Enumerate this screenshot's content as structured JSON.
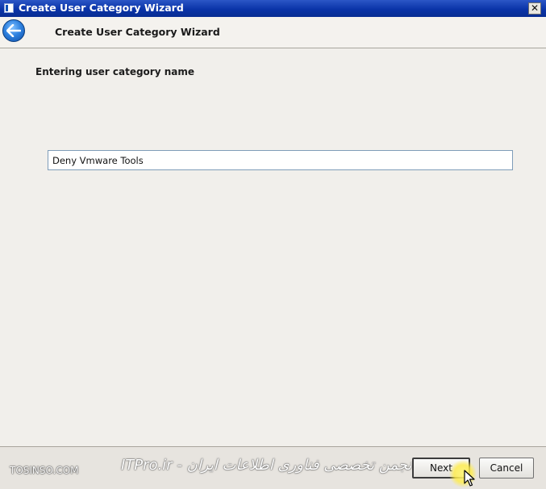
{
  "window": {
    "title": "Create User Category Wizard",
    "close_glyph": "✕"
  },
  "header": {
    "back_icon": "back-arrow-icon",
    "title": "Create User Category Wizard"
  },
  "main": {
    "section_label": "Entering user category name",
    "name_input_value": "Deny Vmware Tools"
  },
  "footer": {
    "watermark_left": "TOSINSO.COM",
    "watermark_center": "ITPro.ir - انجمن تخصصی فناوری اطلاعات ایران",
    "next_label": "Next",
    "cancel_label": "Cancel"
  },
  "colors": {
    "titlebar": "#0a34a8",
    "back_button": "#2f82e0",
    "cursor_highlight": "#ffec46"
  }
}
